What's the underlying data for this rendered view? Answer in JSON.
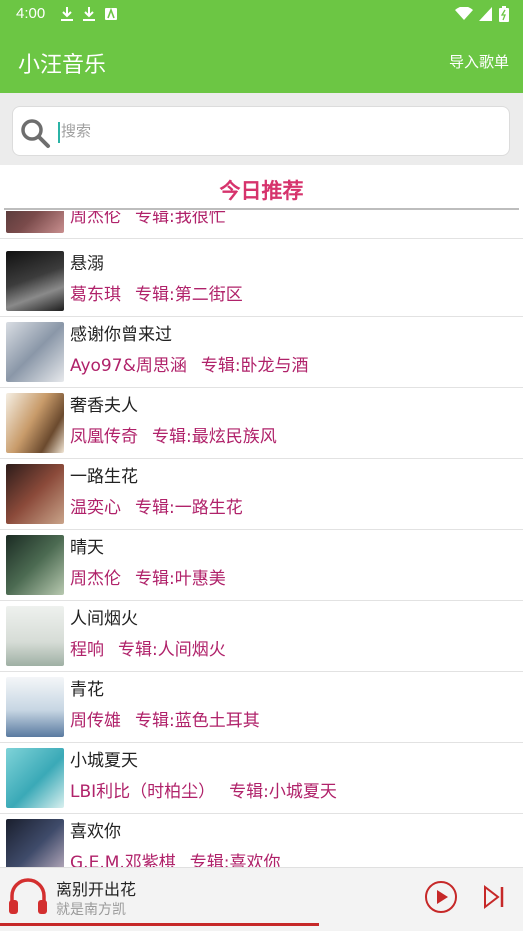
{
  "status_bar": {
    "time": "4:00",
    "icons": [
      "download-icon",
      "download-icon",
      "app-notification-icon",
      "wifi-icon",
      "signal-icon",
      "battery-icon"
    ]
  },
  "app": {
    "title": "小汪音乐",
    "import_label": "导入歌单",
    "accent_color": "#6cc644"
  },
  "search": {
    "placeholder": "搜索",
    "value": ""
  },
  "recommend": {
    "title": "今日推荐"
  },
  "songs": [
    {
      "title": "",
      "artist": "周杰伦",
      "album": "专辑:我很忙"
    },
    {
      "title": "悬溺",
      "artist": "葛东琪",
      "album": "专辑:第二街区"
    },
    {
      "title": "感谢你曾来过",
      "artist": "Ayo97&周思涵",
      "album": "专辑:卧龙与酒"
    },
    {
      "title": "奢香夫人",
      "artist": "凤凰传奇",
      "album": "专辑:最炫民族风"
    },
    {
      "title": "一路生花",
      "artist": "温奕心",
      "album": "专辑:一路生花"
    },
    {
      "title": "晴天",
      "artist": "周杰伦",
      "album": "专辑:叶惠美"
    },
    {
      "title": "人间烟火",
      "artist": "程响",
      "album": "专辑:人间烟火"
    },
    {
      "title": "青花",
      "artist": "周传雄",
      "album": "专辑:蓝色土耳其"
    },
    {
      "title": "小城夏天",
      "artist": "LBI利比（时柏尘）",
      "album": "专辑:小城夏天"
    },
    {
      "title": "喜欢你",
      "artist": "G.E.M.邓紫棋",
      "album": "专辑:喜欢你"
    }
  ],
  "player": {
    "title": "离别开出花",
    "artist": "就是南方凯",
    "progress": 0.61
  }
}
